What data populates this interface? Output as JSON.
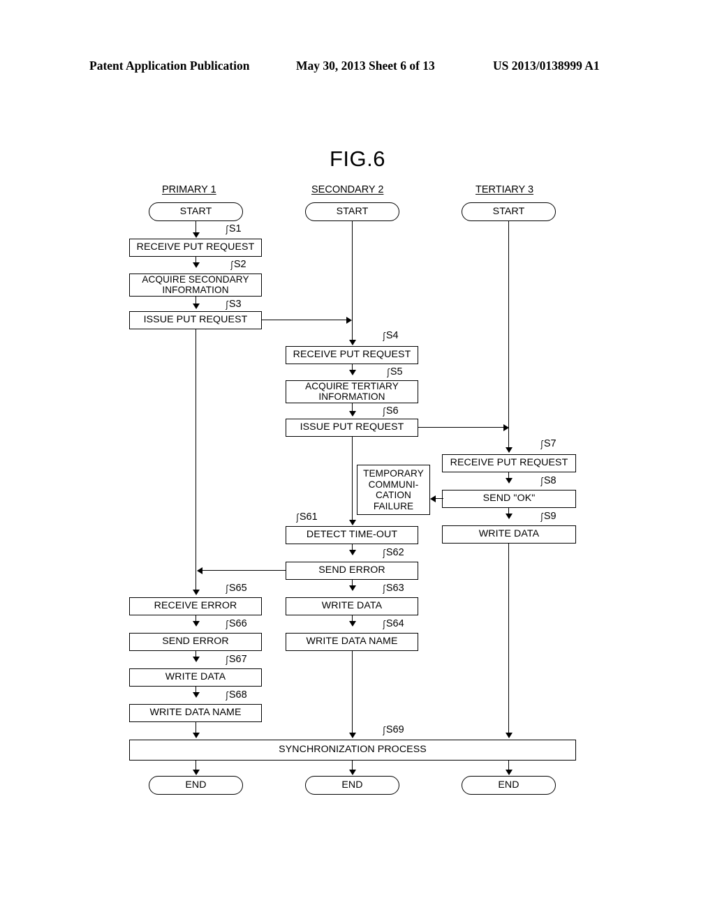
{
  "header": {
    "publication": "Patent Application Publication",
    "date_sheet": "May 30, 2013  Sheet 6 of 13",
    "patent_number": "US 2013/0138999 A1"
  },
  "figure": {
    "title": "FIG.6"
  },
  "columns": [
    {
      "id": "primary",
      "label": "PRIMARY 1"
    },
    {
      "id": "secondary",
      "label": "SECONDARY 2"
    },
    {
      "id": "tertiary",
      "label": "TERTIARY 3"
    }
  ],
  "terminals": {
    "start": "START",
    "end": "END"
  },
  "annotations": {
    "failure": "TEMPORARY\nCOMMUNI-\nCATION\nFAILURE"
  },
  "steps": {
    "s1": {
      "id": "S1",
      "label": "RECEIVE PUT REQUEST"
    },
    "s2": {
      "id": "S2",
      "label": "ACQUIRE SECONDARY\nINFORMATION"
    },
    "s3": {
      "id": "S3",
      "label": "ISSUE PUT REQUEST"
    },
    "s4": {
      "id": "S4",
      "label": "RECEIVE PUT REQUEST"
    },
    "s5": {
      "id": "S5",
      "label": "ACQUIRE TERTIARY\nINFORMATION"
    },
    "s6": {
      "id": "S6",
      "label": "ISSUE PUT REQUEST"
    },
    "s7": {
      "id": "S7",
      "label": "RECEIVE PUT REQUEST"
    },
    "s8": {
      "id": "S8",
      "label": "SEND \"OK\""
    },
    "s9": {
      "id": "S9",
      "label": "WRITE DATA"
    },
    "s61": {
      "id": "S61",
      "label": "DETECT TIME-OUT"
    },
    "s62": {
      "id": "S62",
      "label": "SEND ERROR"
    },
    "s63": {
      "id": "S63",
      "label": "WRITE DATA"
    },
    "s64": {
      "id": "S64",
      "label": "WRITE DATA NAME"
    },
    "s65": {
      "id": "S65",
      "label": "RECEIVE ERROR"
    },
    "s66": {
      "id": "S66",
      "label": "SEND ERROR"
    },
    "s67": {
      "id": "S67",
      "label": "WRITE DATA"
    },
    "s68": {
      "id": "S68",
      "label": "WRITE DATA NAME"
    },
    "s69": {
      "id": "S69",
      "label": "SYNCHRONIZATION PROCESS"
    }
  },
  "colors": {
    "ink": "#000000",
    "paper": "#ffffff"
  }
}
